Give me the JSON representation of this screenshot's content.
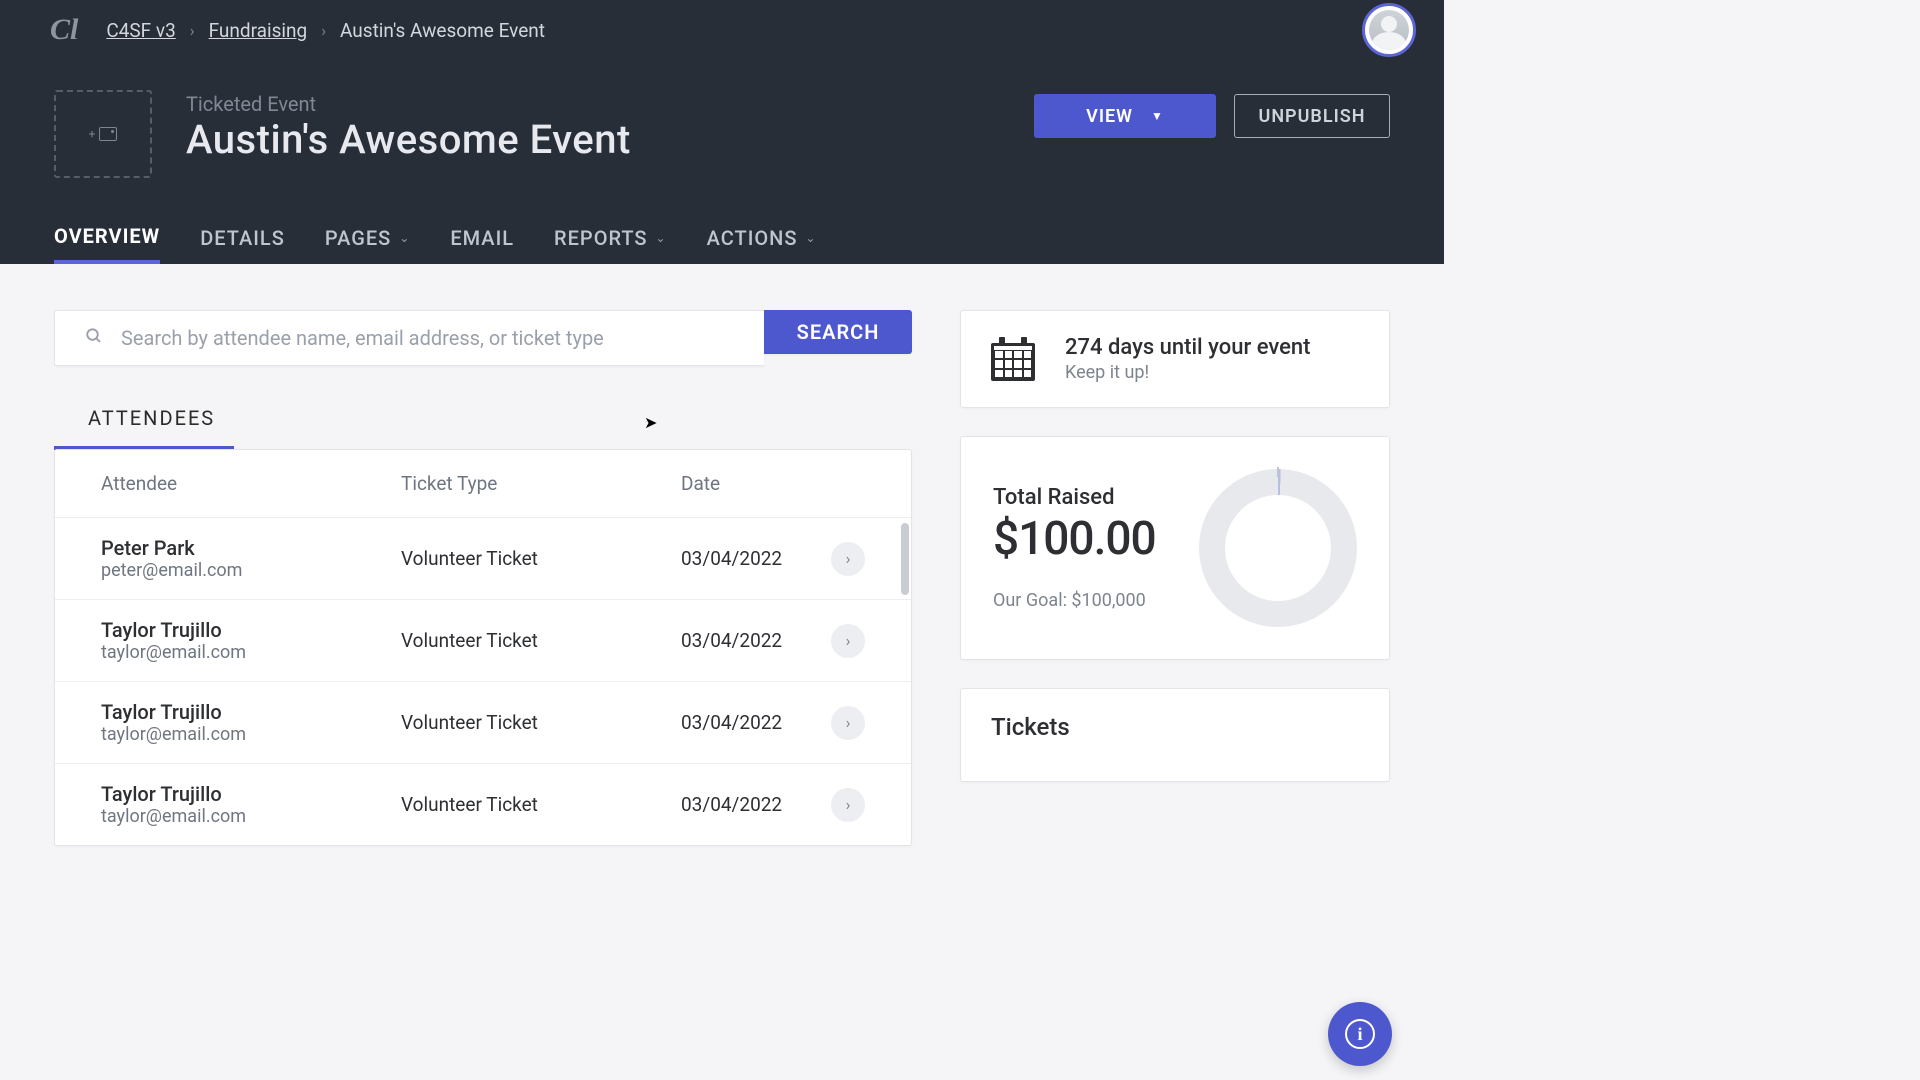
{
  "breadcrumb": {
    "root": "C4SF v3",
    "section": "Fundraising",
    "current": "Austin's Awesome Event"
  },
  "hero": {
    "subtitle": "Ticketed Event",
    "title": "Austin's Awesome Event",
    "view_label": "VIEW",
    "unpublish_label": "UNPUBLISH"
  },
  "tabs": {
    "overview": "OVERVIEW",
    "details": "DETAILS",
    "pages": "PAGES",
    "email": "EMAIL",
    "reports": "REPORTS",
    "actions": "ACTIONS"
  },
  "search": {
    "placeholder": "Search by attendee name, email address, or ticket type",
    "button": "SEARCH"
  },
  "attendees": {
    "tab_label": "ATTENDEES",
    "columns": {
      "attendee": "Attendee",
      "ticket": "Ticket Type",
      "date": "Date"
    },
    "rows": [
      {
        "name": "Peter Park",
        "email": "peter@email.com",
        "ticket": "Volunteer Ticket",
        "date": "03/04/2022"
      },
      {
        "name": "Taylor Trujillo",
        "email": "taylor@email.com",
        "ticket": "Volunteer Ticket",
        "date": "03/04/2022"
      },
      {
        "name": "Taylor Trujillo",
        "email": "taylor@email.com",
        "ticket": "Volunteer Ticket",
        "date": "03/04/2022"
      },
      {
        "name": "Taylor Trujillo",
        "email": "taylor@email.com",
        "ticket": "Volunteer Ticket",
        "date": "03/04/2022"
      }
    ]
  },
  "countdown": {
    "headline": "274 days until your event",
    "sub": "Keep it up!"
  },
  "raised": {
    "title": "Total Raised",
    "amount": "$100.00",
    "goal": "Our Goal: $100,000"
  },
  "tickets": {
    "title": "Tickets"
  }
}
